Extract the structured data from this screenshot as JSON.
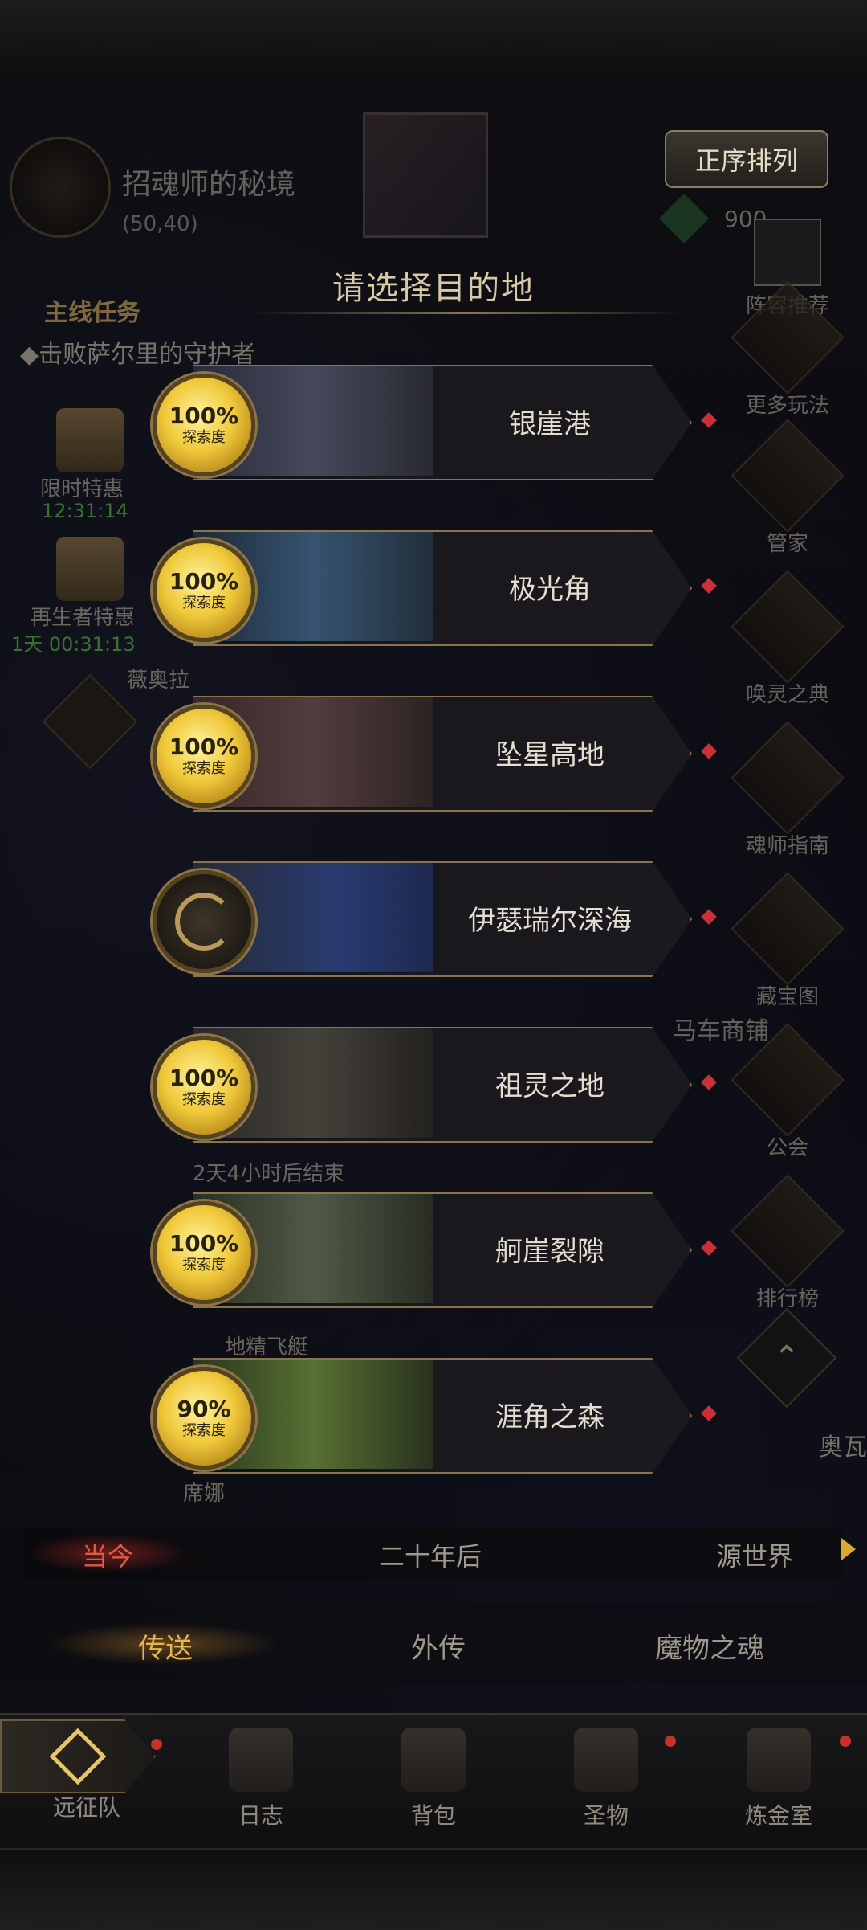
{
  "header": {
    "region_name": "招魂师的秘境",
    "region_coord": "(50,40)",
    "sort_button": "正序排列",
    "gem_count": "900",
    "quest_label": "主线任务",
    "quest_text": "◆击败萨尔里的守护者"
  },
  "dialog": {
    "title": "请选择目的地",
    "destinations": [
      {
        "name": "银崖港",
        "progress": "100%",
        "progress_label": "探索度"
      },
      {
        "name": "极光角",
        "progress": "100%",
        "progress_label": "探索度"
      },
      {
        "name": "坠星高地",
        "progress": "100%",
        "progress_label": "探索度"
      },
      {
        "name": "伊瑟瑞尔深海",
        "progress": "",
        "progress_label": ""
      },
      {
        "name": "祖灵之地",
        "progress": "100%",
        "progress_label": "探索度"
      },
      {
        "name": "舸崖裂隙",
        "progress": "100%",
        "progress_label": "探索度"
      },
      {
        "name": "涯角之森",
        "progress": "90%",
        "progress_label": "探索度"
      }
    ]
  },
  "left_side": {
    "offer1_label": "限时特惠",
    "offer1_timer": "12:31:14",
    "offer2_label": "再生者特惠",
    "offer2_timer": "1天  00:31:13",
    "npc1": "薇奥拉",
    "event_timer": "2天4小时后结束",
    "npc2": "地精飞艇",
    "npc3": "席娜"
  },
  "right_menu": [
    {
      "label": "阵容推荐"
    },
    {
      "label": "更多玩法"
    },
    {
      "label": "管家"
    },
    {
      "label": "唤灵之典"
    },
    {
      "label": "魂师指南"
    },
    {
      "label": "藏宝图"
    },
    {
      "label": "公会"
    },
    {
      "label": "排行榜"
    }
  ],
  "map_labels": {
    "carriage_shop": "马车商铺",
    "edge_text": "奥瓦"
  },
  "era_tabs": [
    "当今",
    "二十年后",
    "源世界"
  ],
  "func_tabs": [
    "传送",
    "外传",
    "魔物之魂"
  ],
  "bottom_nav": [
    "远征队",
    "日志",
    "背包",
    "圣物",
    "炼金室"
  ],
  "colors": {
    "accent_gold": "#e9b252",
    "active_red": "#e05a4a",
    "badge_yellow": "#f0c93a",
    "notify_red": "#c7312c"
  }
}
